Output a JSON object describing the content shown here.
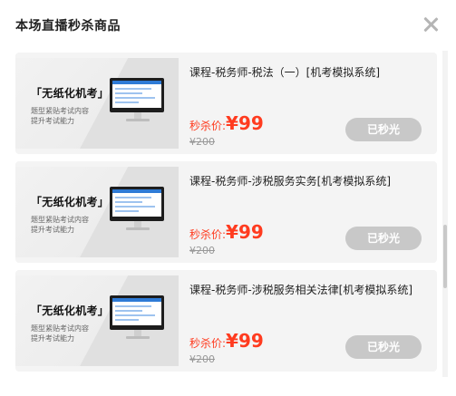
{
  "dialog": {
    "title": "本场直播秒杀商品"
  },
  "products": [
    {
      "thumb_title": "「无纸化机考」",
      "thumb_sub1": "题型紧贴考试内容",
      "thumb_sub2": "提升考试能力",
      "name": "课程-税务师-税法（一）[机考模拟系统]",
      "price_label": "秒杀价:",
      "currency": "¥",
      "price": "99",
      "original_price": "¥200",
      "button_label": "已秒光"
    },
    {
      "thumb_title": "「无纸化机考」",
      "thumb_sub1": "题型紧贴考试内容",
      "thumb_sub2": "提升考试能力",
      "name": "课程-税务师-涉税服务实务[机考模拟系统]",
      "price_label": "秒杀价:",
      "currency": "¥",
      "price": "99",
      "original_price": "¥200",
      "button_label": "已秒光"
    },
    {
      "thumb_title": "「无纸化机考」",
      "thumb_sub1": "题型紧贴考试内容",
      "thumb_sub2": "提升考试能力",
      "name": "课程-税务师-涉税服务相关法律[机考模拟系统]",
      "price_label": "秒杀价:",
      "currency": "¥",
      "price": "99",
      "original_price": "¥200",
      "button_label": "已秒光"
    }
  ],
  "colors": {
    "price": "#ff3b1f",
    "button_disabled": "#c8c8c8",
    "card_bg": "#f4f4f4"
  },
  "icons": {
    "close": "close-icon"
  }
}
